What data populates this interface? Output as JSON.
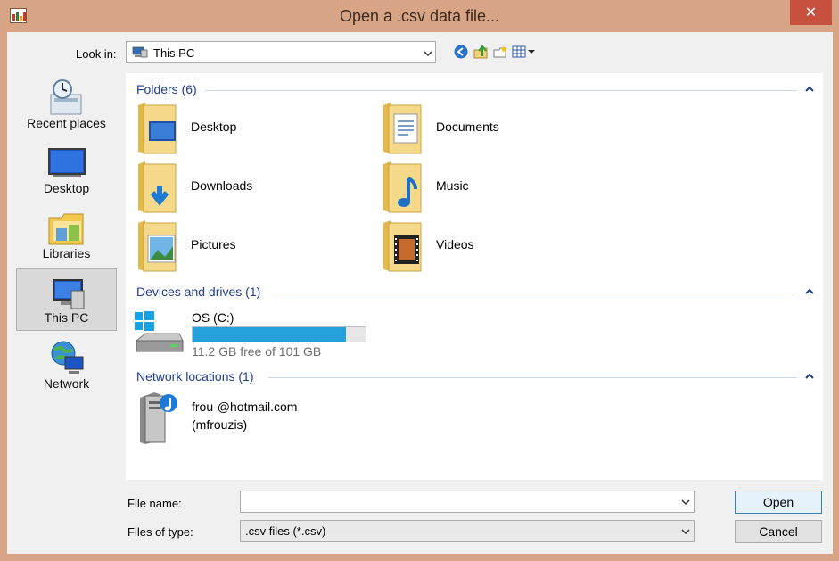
{
  "window": {
    "title": "Open a .csv data file...",
    "close_glyph": "✕"
  },
  "look_in": {
    "label": "Look in:",
    "value": "This PC"
  },
  "places": [
    {
      "label": "Recent places",
      "icon": "recent-places-icon"
    },
    {
      "label": "Desktop",
      "icon": "desktop-icon"
    },
    {
      "label": "Libraries",
      "icon": "libraries-icon"
    },
    {
      "label": "This PC",
      "icon": "this-pc-icon",
      "selected": true
    },
    {
      "label": "Network",
      "icon": "network-icon"
    }
  ],
  "groups": {
    "folders": {
      "title": "Folders (6)"
    },
    "devices": {
      "title": "Devices and drives (1)"
    },
    "network": {
      "title": "Network locations (1)"
    }
  },
  "folders": [
    {
      "name": "Desktop",
      "icon": "desktop-folder-icon"
    },
    {
      "name": "Documents",
      "icon": "documents-folder-icon"
    },
    {
      "name": "Downloads",
      "icon": "downloads-folder-icon"
    },
    {
      "name": "Music",
      "icon": "music-folder-icon"
    },
    {
      "name": "Pictures",
      "icon": "pictures-folder-icon"
    },
    {
      "name": "Videos",
      "icon": "videos-folder-icon"
    }
  ],
  "drive": {
    "name": "OS (C:)",
    "free_text": "11.2 GB free of 101 GB",
    "used_fraction": 0.889,
    "bar_color": "#26a0da"
  },
  "network_location": {
    "line1": "frou-@hotmail.com",
    "line2": "(mfrouzis)"
  },
  "bottom": {
    "file_name_label": "File name:",
    "file_name_value": "",
    "file_type_label": "Files of type:",
    "file_type_value": ".csv files (*.csv)",
    "open_label": "Open",
    "cancel_label": "Cancel"
  },
  "colors": {
    "frame": "#d7a485",
    "close": "#c7503f",
    "group_header": "#1e3d8f",
    "folder": "#f2d27a"
  }
}
